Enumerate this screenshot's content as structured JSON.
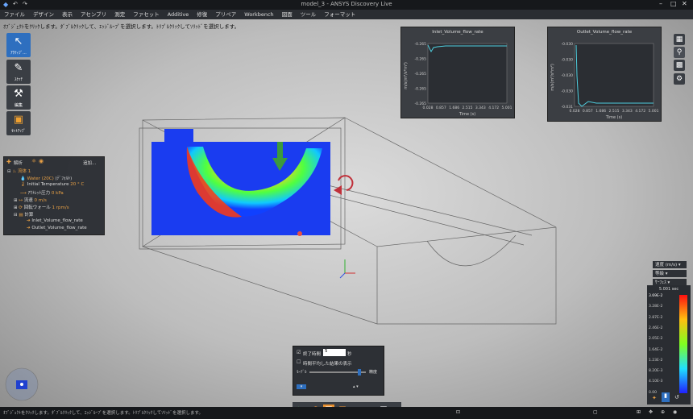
{
  "app": {
    "window_title": "model_3 - ANSYS Discovery Live",
    "status_text": "ｵﾌﾞｼﾞｪｸﾄをｸﾘｯｸします。ﾀﾞﾌﾞﾙｸﾘｯｸして、ｴｯｼﾞﾙｰﾌﾟを選択します。ﾄﾘﾌﾟﾙｸﾘｯｸしてｿﾘｯﾄﾞを選択します。"
  },
  "menu": [
    "ファイル",
    "デザイン",
    "表示",
    "アセンブリ",
    "測定",
    "ファセット",
    "Additive",
    "修復",
    "プリペア",
    "Workbench",
    "図面",
    "ツール",
    "フォーマット"
  ],
  "viewport": {
    "hint": "ｵﾌﾞｼﾞｪｸﾄをｸﾘｯｸします。ﾀﾞﾌﾞﾙｸﾘｯｸして、ｴｯｼﾞﾙｰﾌﾟを選択します。ﾄﾘﾌﾟﾙｸﾘｯｸしてｿﾘｯﾄﾞを選択します。"
  },
  "tools": [
    {
      "label": "ｱｸﾃｨﾌﾞ...",
      "icon": "↖"
    },
    {
      "label": "ｽｹｯﾁ",
      "icon": "✎"
    },
    {
      "label": "編集",
      "icon": "⚒"
    },
    {
      "label": "ｾｯﾄｱｯﾌﾟ",
      "icon": "▣"
    }
  ],
  "tree": {
    "header_analysis": "解析",
    "header_add": "追加...",
    "items": [
      {
        "label": "流体 1",
        "value": "",
        "unit": ""
      },
      {
        "label": "Water (20C)",
        "value": "(ﾃﾞﾌｫﾙﾄ)",
        "unit": ""
      },
      {
        "label": "Initial Temperature",
        "value": "20 ° C",
        "unit": ""
      },
      {
        "label": "ｱｳﾄﾚｯﾄ圧力",
        "value": "0 kPa",
        "unit": ""
      },
      {
        "label": "流速",
        "value": "0 m/s",
        "unit": ""
      },
      {
        "label": "回転ウォール",
        "value": "1 rpm/s",
        "unit": ""
      },
      {
        "label": "計算",
        "value": "",
        "unit": ""
      },
      {
        "label": "Inlet_Volume_flow_rate",
        "value": "",
        "unit": ""
      },
      {
        "label": "Outlet_Volume_flow_rate",
        "value": "",
        "unit": ""
      }
    ]
  },
  "charts": [
    {
      "title": "Inlet_Volume_flow_rate",
      "ylabel": "m/s(m³/s*m²)",
      "xlabel": "Time (s)",
      "yticks": [
        "-0.265",
        "-0.265",
        "-0.265",
        "-0.265",
        "-0.265"
      ],
      "xticks": [
        "0.028",
        "0.857",
        "1.686",
        "2.515",
        "3.343",
        "4.172",
        "5.001"
      ]
    },
    {
      "title": "Outlet_Volume_flow_rate",
      "ylabel": "m/s(m³/s*m²)",
      "xlabel": "Time (s)",
      "yticks": [
        "-0.030",
        "-0.030",
        "-0.030",
        "-0.030",
        "-0.031"
      ],
      "xticks": [
        "0.028",
        "0.857",
        "1.686",
        "2.515",
        "3.343",
        "4.172",
        "5.001"
      ]
    }
  ],
  "legend": {
    "quantity": "速度 (m/s)",
    "mode": "等級",
    "surface": "ｻｰﾌｪｽ",
    "time": "5.001 sec",
    "values": [
      "3.69E-2",
      "3.28E-2",
      "2.87E-2",
      "2.46E-2",
      "2.05E-2",
      "1.64E-2",
      "1.23E-2",
      "8.20E-3",
      "4.10E-3",
      "0.00"
    ]
  },
  "timepanel": {
    "end_time_label": "終了時間",
    "end_time_value": "5",
    "end_time_unit": "秒",
    "avg_label": "時間平均した結果の表示",
    "slider_left": "ﾓｰﾃﾞﾙ",
    "slider_right": "精度"
  },
  "colors": {
    "accent": "#2e6fbf",
    "series": "#4fd0e0"
  }
}
